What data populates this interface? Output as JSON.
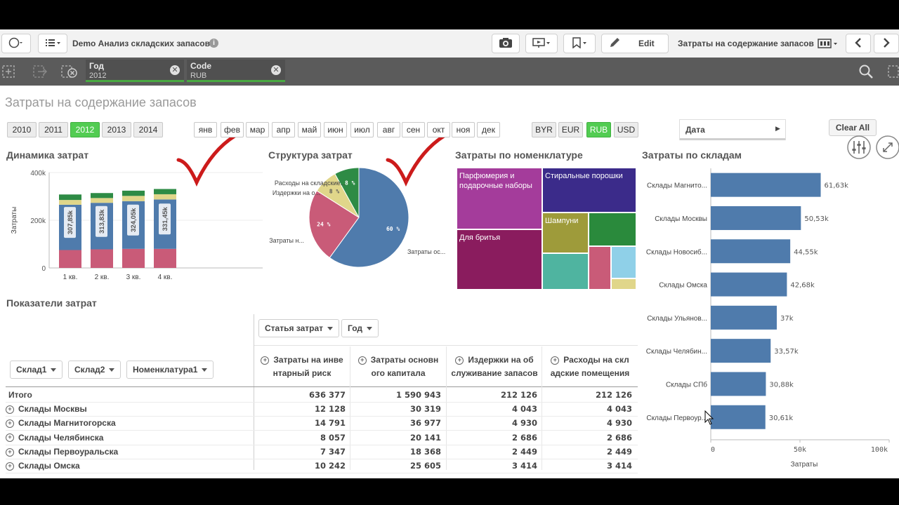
{
  "app": {
    "title": "Demo Анализ складских запасов",
    "edit_label": "Edit",
    "sheet_name": "Затраты на содержание запасов"
  },
  "selections": [
    {
      "field": "Год",
      "value": "2012"
    },
    {
      "field": "Code",
      "value": "RUB"
    }
  ],
  "sheet": {
    "title": "Затраты на содержание запасов",
    "years": [
      {
        "label": "2010",
        "selected": false
      },
      {
        "label": "2011",
        "selected": false
      },
      {
        "label": "2012",
        "selected": true
      },
      {
        "label": "2013",
        "selected": false
      },
      {
        "label": "2014",
        "selected": false
      }
    ],
    "months": [
      "янв",
      "фев",
      "мар",
      "апр",
      "май",
      "июн",
      "июл",
      "авг",
      "сен",
      "окт",
      "ноя",
      "дек"
    ],
    "currencies": [
      {
        "label": "BYR",
        "selected": false
      },
      {
        "label": "EUR",
        "selected": false
      },
      {
        "label": "RUB",
        "selected": true
      },
      {
        "label": "USD",
        "selected": false
      }
    ],
    "date_filter": "Дата",
    "clear_all": "Clear All"
  },
  "panels": {
    "dynamics": "Динамика затрат",
    "structure": "Структура затрат",
    "nomenclature": "Затраты по номенклатуре",
    "warehouses": "Затраты по складам",
    "indicators": "Показатели затрат"
  },
  "colors": {
    "selected_green": "#52cc52",
    "bar_blue": "#4f7bac",
    "bar_red": "#c95b78",
    "bar_yellow": "#e0d68a",
    "bar_green": "#2e8b45",
    "checkmark_red": "#cc1b1b"
  },
  "chart_data": [
    {
      "type": "bar",
      "stacked": true,
      "title": "Динамика затрат",
      "ylabel": "Затраты",
      "categories": [
        "1 кв.",
        "2 кв.",
        "3 кв.",
        "4 кв."
      ],
      "totals_labels": [
        "307,85k",
        "313,83k",
        "324,05k",
        "331,45k"
      ],
      "series": [
        {
          "values": [
            75,
            78,
            80,
            80
          ]
        },
        {
          "values": [
            190,
            195,
            200,
            207
          ]
        },
        {
          "values": [
            20,
            20,
            22,
            22
          ]
        },
        {
          "values": [
            23,
            21,
            22,
            22
          ]
        }
      ],
      "y_ticks": [
        "0",
        "200k",
        "400k"
      ],
      "ylim": [
        0,
        400
      ]
    },
    {
      "type": "pie",
      "title": "Структура затрат",
      "slices": [
        {
          "label": "Затраты ос...",
          "pct_label": "60 %",
          "value": 60
        },
        {
          "label": "Затраты н...",
          "pct_label": "24 %",
          "value": 24
        },
        {
          "label": "Издержки на о...",
          "pct_label": "8 %",
          "value": 8
        },
        {
          "label": "Расходы на складские...",
          "pct_label": "8 %",
          "value": 8
        }
      ]
    },
    {
      "type": "treemap",
      "title": "Затраты по номенклатуре",
      "items": [
        {
          "label": "Парфюмерия и подарочные наборы"
        },
        {
          "label": "Стиральные порошки"
        },
        {
          "label": "Для бритья"
        },
        {
          "label": "Шампуни"
        }
      ]
    },
    {
      "type": "bar",
      "orientation": "horizontal",
      "title": "Затраты по складам",
      "xlabel": "Затраты",
      "categories": [
        "Склады Магнито...",
        "Склады Москвы",
        "Склады Новосиб...",
        "Склады Омска",
        "Склады Ульянов...",
        "Склады Челябин...",
        "Склады СПб",
        "Склады Первоур..."
      ],
      "values": [
        61.63,
        50.53,
        44.55,
        42.68,
        37,
        33.57,
        30.88,
        30.61
      ],
      "value_labels": [
        "61,63k",
        "50,53k",
        "44,55k",
        "42,68k",
        "37k",
        "33,57k",
        "30,88k",
        "30,61k"
      ],
      "x_ticks": [
        "0",
        "50k",
        "100k"
      ],
      "xlim": [
        0,
        100
      ]
    }
  ],
  "table": {
    "row_dims": [
      "Склад1",
      "Склад2",
      "Номенклатура1"
    ],
    "col_dims": [
      "Статья затрат",
      "Год"
    ],
    "columns": [
      [
        "Затраты на инве",
        "нтарный риск"
      ],
      [
        "Затраты основн",
        "ого капитала"
      ],
      [
        "Издержки на об",
        "служивание запасов"
      ],
      [
        "Расходы на скл",
        "адские помещения"
      ]
    ],
    "rows": [
      {
        "label": "Итого",
        "expandable": false,
        "values": [
          "636 377",
          "1 590 943",
          "212 126",
          "212 126"
        ]
      },
      {
        "label": "Склады Москвы",
        "expandable": true,
        "values": [
          "12 128",
          "30 319",
          "4 043",
          "4 043"
        ]
      },
      {
        "label": "Склады Магнитогорска",
        "expandable": true,
        "values": [
          "14 791",
          "36 977",
          "4 930",
          "4 930"
        ]
      },
      {
        "label": "Склады Челябинска",
        "expandable": true,
        "values": [
          "8 057",
          "20 141",
          "2 686",
          "2 686"
        ]
      },
      {
        "label": "Склады Первоуральска",
        "expandable": true,
        "values": [
          "7 347",
          "18 368",
          "2 449",
          "2 449"
        ]
      },
      {
        "label": "Склады Омска",
        "expandable": true,
        "values": [
          "10 242",
          "25 605",
          "3 414",
          "3 414"
        ]
      }
    ]
  }
}
